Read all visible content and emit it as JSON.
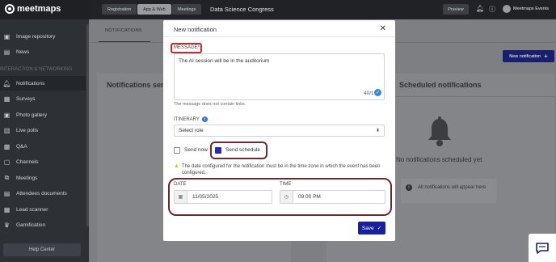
{
  "brand": {
    "name": "meetmaps"
  },
  "topbar": {
    "tabs": [
      {
        "label": "Registration",
        "active": false
      },
      {
        "label": "App & Web",
        "active": true
      },
      {
        "label": "Meetings",
        "active": false
      }
    ],
    "event_name": "Data Science Congress",
    "preview_label": "Preview",
    "user_label": "Meetmaps Events"
  },
  "sidebar": {
    "items": [
      {
        "label": "Image repository",
        "icon": "image-icon"
      },
      {
        "label": "News",
        "icon": "news-icon"
      },
      {
        "label": "Notifications",
        "icon": "bell-icon",
        "active": true
      },
      {
        "label": "Surveys",
        "icon": "survey-icon"
      },
      {
        "label": "Photo gallery",
        "icon": "photo-icon"
      },
      {
        "label": "Live polls",
        "icon": "poll-icon"
      },
      {
        "label": "Q&A",
        "icon": "qa-icon"
      },
      {
        "label": "Channels",
        "icon": "channel-icon"
      },
      {
        "label": "Meetings",
        "icon": "handshake-icon"
      },
      {
        "label": "Attendees documents",
        "icon": "document-icon"
      },
      {
        "label": "Lead scanner",
        "icon": "scanner-icon"
      },
      {
        "label": "Gamification",
        "icon": "trophy-icon"
      }
    ],
    "section_label": "INTERACTION & NETWORKING",
    "help_label": "Help Center"
  },
  "main": {
    "tab_label": "NOTIFICATIONS",
    "new_button_label": "New notification",
    "sent_title": "Notifications sent",
    "scheduled_title": "Scheduled notifications",
    "empty_title": "No notifications scheduled yet",
    "empty_info": "All notifications will appear here"
  },
  "modal": {
    "title": "New notification",
    "message_label": "MESSAGE*",
    "message_value": "The AI session will be in the auditorium",
    "char_count": "40/1",
    "message_help": "The message does not contain links.",
    "itinerary_label": "ITINERARY",
    "role_placeholder": "Select role",
    "send_now_label": "Send now",
    "send_now_checked": false,
    "send_schedule_label": "Send schedule",
    "send_schedule_checked": true,
    "warning": "The date configured for the notification must be in the time zone in which the event has been configured.",
    "date_label": "DATE",
    "date_value": "11/05/2025",
    "time_label": "TIME",
    "time_value": "09:00 PM",
    "save_label": "Save"
  },
  "colors": {
    "accent": "#1a1f9c",
    "annotation": "#6b2a2e",
    "annotation_red": "#c9262c",
    "checkbox": "#2a27b8"
  }
}
